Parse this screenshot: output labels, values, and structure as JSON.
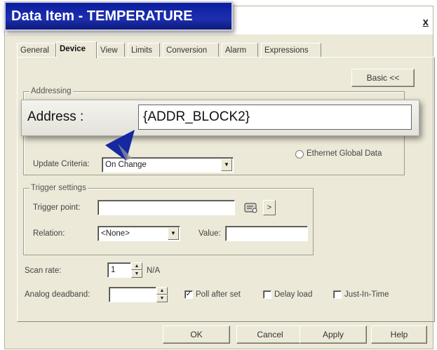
{
  "window": {
    "title": "Data Item - TEMPERATURE",
    "close_glyph": "x"
  },
  "tabs": [
    "General",
    "Device",
    "View",
    "Limits",
    "Conversion",
    "Alarm",
    "Expressions"
  ],
  "active_tab": "Device",
  "basic_button": "Basic <<",
  "addressing": {
    "group_title": "Addressing",
    "address_label": "Address :",
    "address_value": "{ADDR_BLOCK2}",
    "ethernet_global_data_label": "Ethernet Global Data",
    "update_criteria_label": "Update Criteria:",
    "update_criteria_value": "On Change"
  },
  "trigger": {
    "group_title": "Trigger settings",
    "trigger_point_label": "Trigger point:",
    "trigger_point_value": "",
    "relation_label": "Relation:",
    "relation_value": "<None>",
    "value_label": "Value:",
    "value_value": "",
    "more_glyph": ">"
  },
  "scan": {
    "scan_rate_label": "Scan rate:",
    "scan_rate_value": "1",
    "scan_rate_unit": "N/A",
    "analog_deadband_label": "Analog deadband:",
    "analog_deadband_value": ""
  },
  "options": {
    "poll_after_set_label": "Poll after set",
    "poll_after_set_checked": true,
    "delay_load_label": "Delay load",
    "delay_load_checked": false,
    "just_in_time_label": "Just-In-Time",
    "just_in_time_checked": false,
    "check_glyph": "✓"
  },
  "footer_buttons": {
    "ok": "OK",
    "cancel": "Cancel",
    "apply": "Apply",
    "help": "Help"
  },
  "colors": {
    "dialog_bg": "#ece9d8",
    "title_badge": "#0a1d9e",
    "pointer": "#1428a0"
  }
}
